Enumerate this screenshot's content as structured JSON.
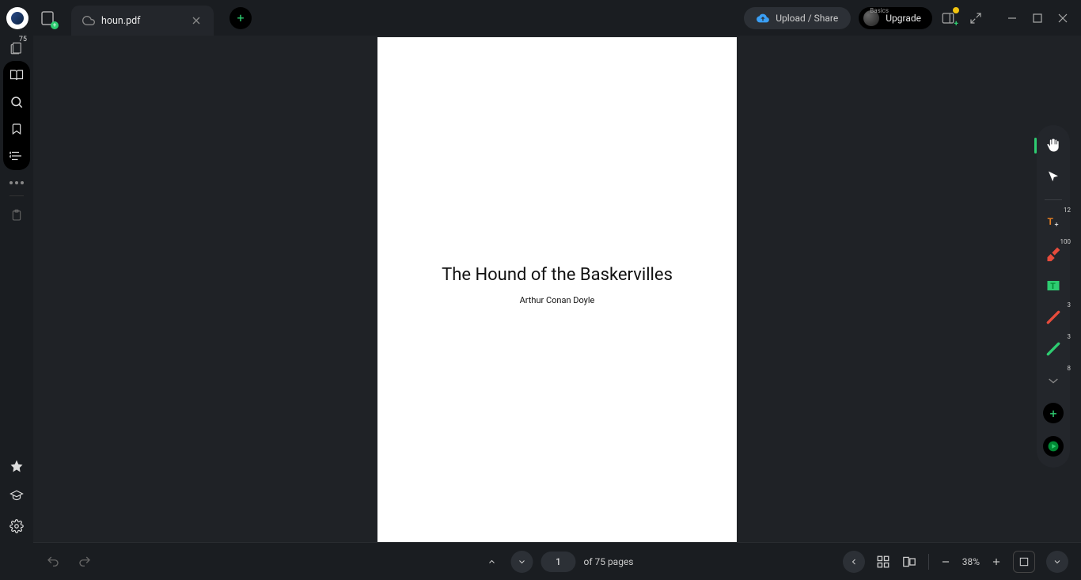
{
  "titlebar": {
    "tab_title": "houn.pdf",
    "upload_label": "Upload / Share",
    "upgrade_small": "Basics",
    "upgrade_label": "Upgrade"
  },
  "left_sidebar": {
    "page_count": "75"
  },
  "document": {
    "title": "The Hound of the Baskervilles",
    "author": "Arthur Conan Doyle"
  },
  "right_toolbar": {
    "text_badge": "12",
    "highlighter_badge": "100",
    "redline_badge": "3",
    "greenline_badge": "3",
    "expand_badge": "8"
  },
  "bottombar": {
    "current_page": "1",
    "page_label": "of 75 pages",
    "zoom_level": "38%"
  }
}
